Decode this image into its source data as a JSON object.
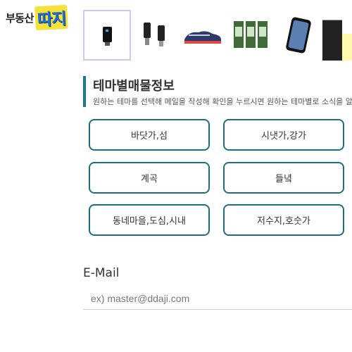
{
  "logo": {
    "small": "부동산",
    "big": "따지"
  },
  "products": [
    {
      "icon": "usb-adapter-icon",
      "selected": true
    },
    {
      "icon": "charging-cable-icon",
      "selected": false
    },
    {
      "icon": "sneakers-icon",
      "selected": false
    },
    {
      "icon": "screen-protector-pack-icon",
      "selected": false
    },
    {
      "icon": "phone-case-icon",
      "selected": false
    }
  ],
  "section": {
    "title": "테마별매물정보",
    "description": "원하는 테마를 선택해 메일을 작성해 확인을 누르시면 원하는 테마별로 소식을 알려"
  },
  "themes": [
    {
      "label": "바닷가,섬"
    },
    {
      "label": "시냇가,강가"
    },
    {
      "label": "계곡"
    },
    {
      "label": "들녘"
    },
    {
      "label": "동네마을,도심,시내"
    },
    {
      "label": "저수지,호숫가"
    }
  ],
  "email": {
    "label": "E-Mail",
    "placeholder": "ex) master@ddaji.com",
    "value": ""
  },
  "colors": {
    "accent": "#1d6f80",
    "logo_blue": "#1f6fd6",
    "logo_yellow": "#f7e23a"
  }
}
